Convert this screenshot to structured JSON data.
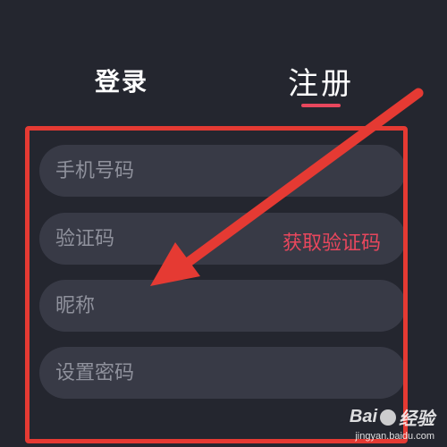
{
  "tabs": {
    "login_label": "登录",
    "register_label": "注册"
  },
  "form": {
    "phone_placeholder": "手机号码",
    "code_placeholder": "验证码",
    "get_code_label": "获取验证码",
    "nickname_placeholder": "昵称",
    "password_placeholder": "设置密码"
  },
  "colors": {
    "background": "#24262f",
    "field": "#383a46",
    "accent": "#e8475d",
    "annotation": "#e53a33"
  },
  "watermark": {
    "brand_a": "Bai",
    "brand_b": "经验",
    "url": "jingyan.baidu.com"
  },
  "icons": {
    "annotation_arrow": "arrow-icon",
    "watermark_paw": "paw-icon"
  }
}
